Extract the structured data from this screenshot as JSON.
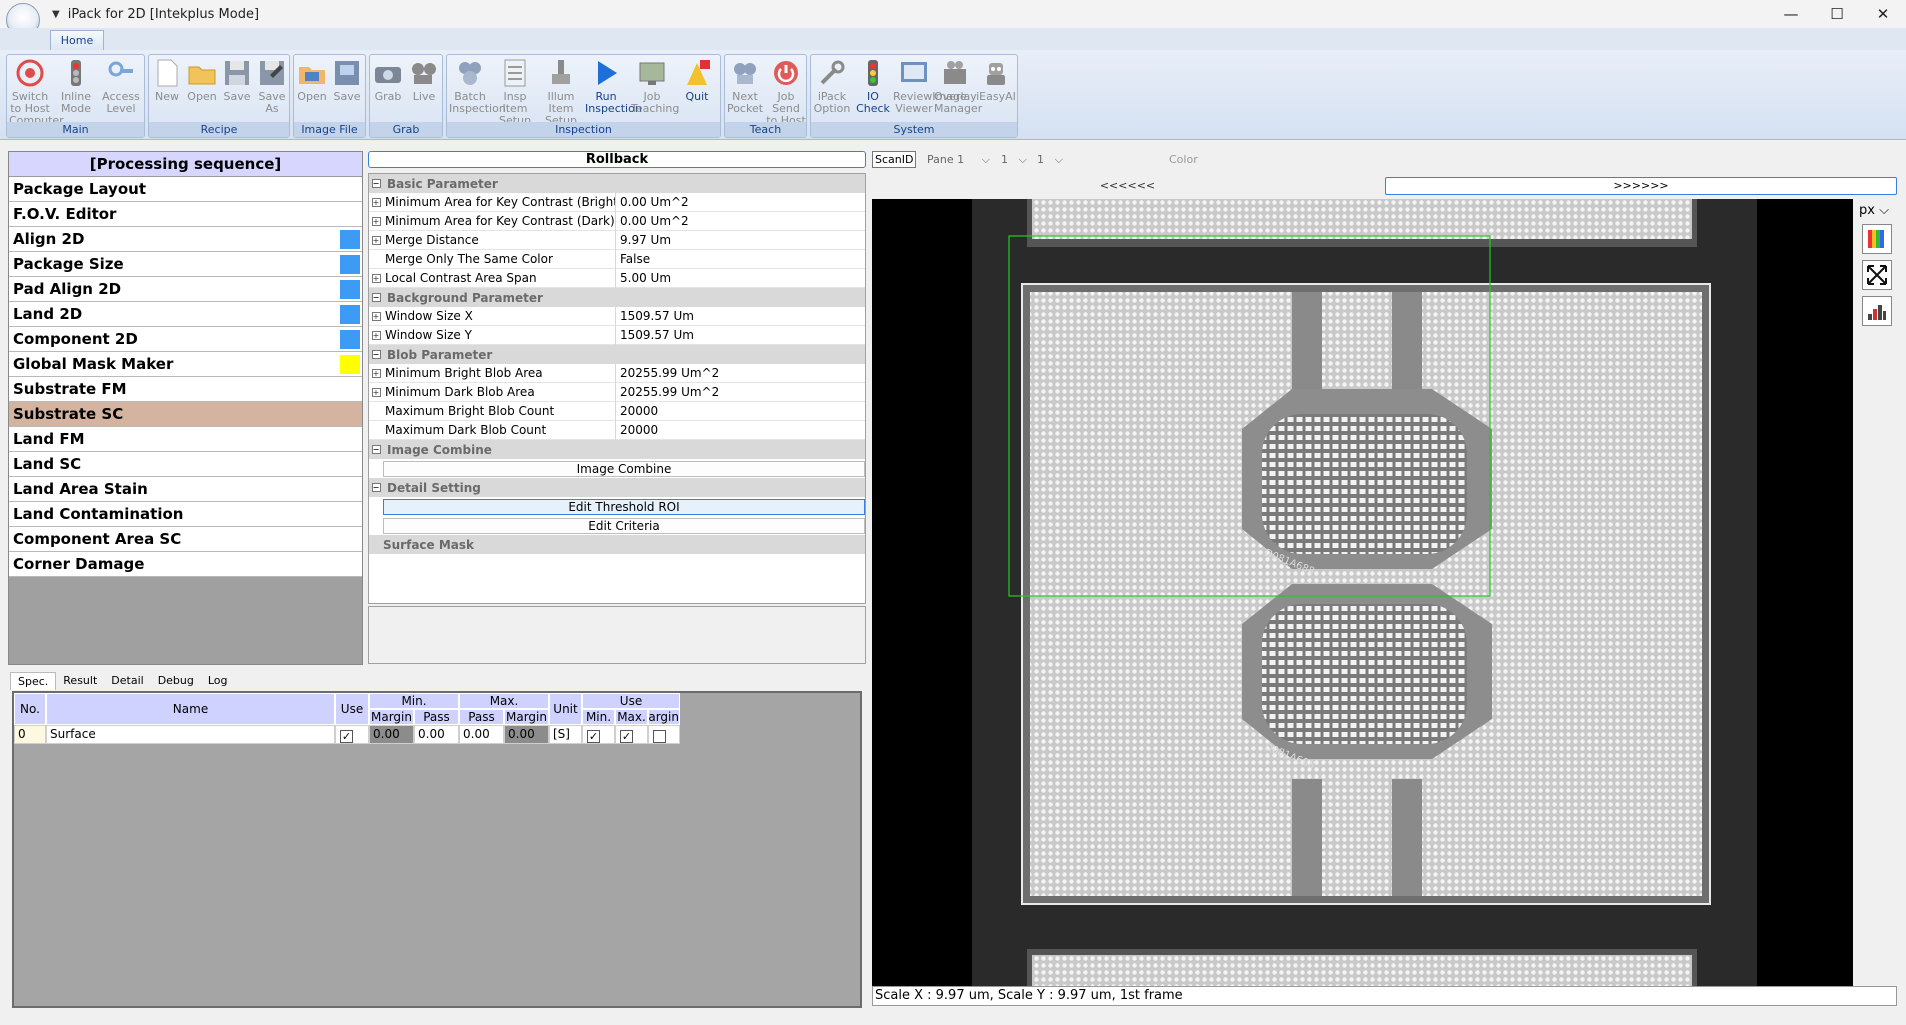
{
  "window": {
    "title": "iPack for 2D [Intekplus Mode]",
    "minimize": "—",
    "maximize": "☐",
    "close": "✕"
  },
  "ribbon": {
    "tab": "Home",
    "groups": [
      {
        "label": "Main",
        "buttons": [
          {
            "label": "Switch to Host Computer",
            "icon": "target-icon"
          },
          {
            "label": "Inline Mode",
            "icon": "traffic-light-icon"
          },
          {
            "label": "Access Level",
            "icon": "key-icon"
          }
        ]
      },
      {
        "label": "Recipe",
        "buttons": [
          {
            "label": "New",
            "icon": "new-file-icon"
          },
          {
            "label": "Open",
            "icon": "folder-icon"
          },
          {
            "label": "Save",
            "icon": "save-icon"
          },
          {
            "label": "Save As",
            "icon": "save-as-icon"
          }
        ]
      },
      {
        "label": "Image File",
        "buttons": [
          {
            "label": "Open",
            "icon": "image-open-icon"
          },
          {
            "label": "Save",
            "icon": "image-save-icon"
          }
        ]
      },
      {
        "label": "Grab",
        "buttons": [
          {
            "label": "Grab",
            "icon": "camera-icon"
          },
          {
            "label": "Live",
            "icon": "film-icon"
          }
        ]
      },
      {
        "label": "Inspection",
        "buttons": [
          {
            "label": "Batch Inspection",
            "icon": "batch-icon"
          },
          {
            "label": "Insp Item Setup",
            "icon": "checklist-icon"
          },
          {
            "label": "Illum Item Setup",
            "icon": "lamp-icon"
          },
          {
            "label": "Run Inspection",
            "icon": "play-icon",
            "active": true
          },
          {
            "label": "Job Teaching",
            "icon": "monitor-icon"
          },
          {
            "label": "Quit",
            "icon": "quit-icon",
            "active": true
          }
        ]
      },
      {
        "label": "Teach",
        "buttons": [
          {
            "label": "Next Pocket",
            "icon": "pocket-icon"
          },
          {
            "label": "Job Send to Host",
            "icon": "power-icon"
          }
        ]
      },
      {
        "label": "System",
        "buttons": [
          {
            "label": "iPack Option",
            "icon": "wrench-icon"
          },
          {
            "label": "IO Check",
            "icon": "io-light-icon",
            "active": true
          },
          {
            "label": "ReviewImage Viewer",
            "icon": "viewer-icon"
          },
          {
            "label": "Overlay Manager",
            "icon": "overlay-icon"
          },
          {
            "label": "iEasyAI",
            "icon": "robot-icon"
          }
        ]
      }
    ]
  },
  "sequence": {
    "header": "[Processing sequence]",
    "items": [
      {
        "label": "Package Layout",
        "swatch": ""
      },
      {
        "label": "F.O.V. Editor",
        "swatch": ""
      },
      {
        "label": "Align 2D",
        "swatch": "#3d9bf5"
      },
      {
        "label": "Package Size",
        "swatch": "#3d9bf5"
      },
      {
        "label": "Pad Align 2D",
        "swatch": "#3d9bf5"
      },
      {
        "label": "Land 2D",
        "swatch": "#3d9bf5"
      },
      {
        "label": "Component 2D",
        "swatch": "#3d9bf5"
      },
      {
        "label": "Global Mask Maker",
        "swatch": "#ffff00"
      },
      {
        "label": "Substrate FM",
        "swatch": ""
      },
      {
        "label": "Substrate SC",
        "swatch": "",
        "selected": true
      },
      {
        "label": "Land FM",
        "swatch": ""
      },
      {
        "label": "Land SC",
        "swatch": ""
      },
      {
        "label": "Land Area Stain",
        "swatch": ""
      },
      {
        "label": "Land Contamination",
        "swatch": ""
      },
      {
        "label": "Component Area SC",
        "swatch": ""
      },
      {
        "label": "Corner Damage",
        "swatch": ""
      }
    ]
  },
  "params": {
    "rollback": "Rollback",
    "sections": [
      {
        "title": "Basic Parameter",
        "rows": [
          {
            "name": "Minimum Area for Key Contrast (Bright)",
            "value": "0.00 Um^2",
            "expand": true
          },
          {
            "name": "Minimum Area for Key Contrast (Dark)",
            "value": "0.00 Um^2",
            "expand": true
          },
          {
            "name": "Merge Distance",
            "value": "9.97 Um",
            "expand": true
          },
          {
            "name": "Merge Only The Same Color",
            "value": "False",
            "expand": false
          },
          {
            "name": "Local Contrast Area Span",
            "value": "5.00 Um",
            "expand": true
          }
        ]
      },
      {
        "title": "Background Parameter",
        "rows": [
          {
            "name": "Window Size X",
            "value": "1509.57 Um",
            "expand": true
          },
          {
            "name": "Window Size Y",
            "value": "1509.57 Um",
            "expand": true
          }
        ]
      },
      {
        "title": "Blob Parameter",
        "rows": [
          {
            "name": "Minimum Bright Blob Area",
            "value": "20255.99 Um^2",
            "expand": true
          },
          {
            "name": "Minimum Dark Blob Area",
            "value": "20255.99 Um^2",
            "expand": true
          },
          {
            "name": "Maximum Bright Blob Count",
            "value": "20000",
            "expand": false
          },
          {
            "name": "Maximum Dark Blob Count",
            "value": "20000",
            "expand": false
          }
        ]
      }
    ],
    "image_combine": {
      "title": "Image Combine",
      "button": "Image Combine"
    },
    "detail": {
      "title": "Detail Setting",
      "button1": "Edit Threshold  ROI",
      "button2": "Edit Criteria"
    },
    "surface_mask": "Surface Mask"
  },
  "bottom_tabs": [
    "Spec.",
    "Result",
    "Detail",
    "Debug",
    "Log"
  ],
  "spec": {
    "headers": {
      "no": "No.",
      "name": "Name",
      "use": "Use",
      "min": "Min.",
      "max": "Max.",
      "unit": "Unit",
      "use2": "Use",
      "margin": "Margin",
      "pass": "Pass",
      "min_short": "Min.",
      "max_short": "Max.",
      "margin_short": "Margin"
    },
    "row": {
      "no": "0",
      "name": "Surface",
      "min_margin": "0.00",
      "min_pass": "0.00",
      "max_pass": "0.00",
      "max_margin": "0.00",
      "unit": "[S]"
    }
  },
  "viewer": {
    "scan_id": "ScanID",
    "pane": "Pane 1",
    "sel1": "1",
    "sel2": "1",
    "color": "Color",
    "prev": "<<<<<<",
    "next": ">>>>>>",
    "unit": "px",
    "status": "Scale X : 9.97 um, Scale Y : 9.97 um, 1st frame",
    "side_icons": [
      "color-map-icon",
      "fit-view-icon",
      "histogram-icon"
    ],
    "chip_marking": "D081A688",
    "accent_roi": "#22cc22"
  }
}
